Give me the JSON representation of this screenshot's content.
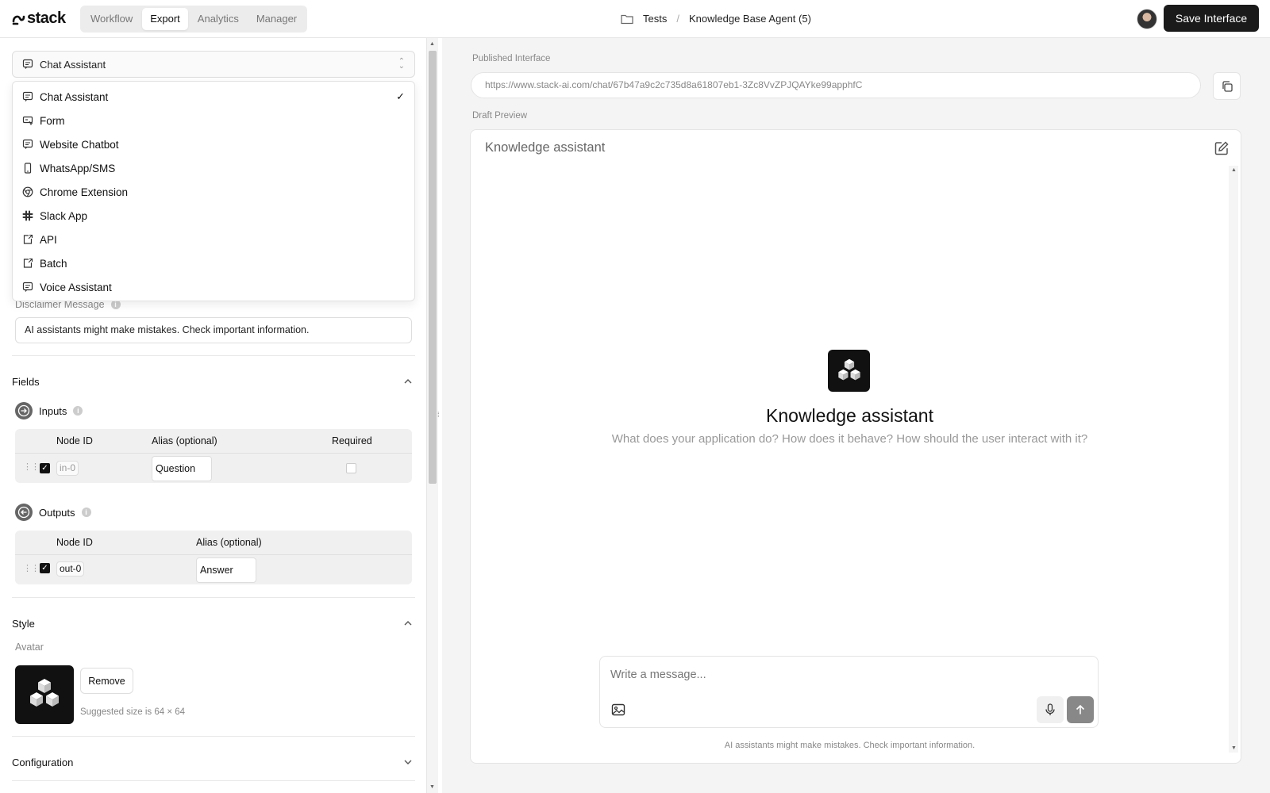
{
  "app": {
    "logo_text": "stack"
  },
  "nav": {
    "tabs": [
      "Workflow",
      "Export",
      "Analytics",
      "Manager"
    ],
    "active": "Export"
  },
  "breadcrumb": {
    "folder": "Tests",
    "project": "Knowledge Base Agent (5)"
  },
  "header": {
    "save_label": "Save Interface"
  },
  "export_type": {
    "selected": "Chat Assistant",
    "options": [
      "Chat Assistant",
      "Form",
      "Website Chatbot",
      "WhatsApp/SMS",
      "Chrome Extension",
      "Slack App",
      "API",
      "Batch",
      "Voice Assistant"
    ]
  },
  "disclaimer": {
    "label": "Disclaimer Message",
    "value": "AI assistants might make mistakes. Check important information."
  },
  "fields": {
    "title": "Fields",
    "inputs": {
      "title": "Inputs",
      "headers": [
        "Node ID",
        "Alias (optional)",
        "Required"
      ],
      "rows": [
        {
          "node_id": "in-0",
          "alias": "Question",
          "checked": true,
          "required": false
        }
      ]
    },
    "outputs": {
      "title": "Outputs",
      "headers": [
        "Node ID",
        "Alias (optional)"
      ],
      "rows": [
        {
          "node_id": "out-0",
          "alias": "Answer",
          "checked": true
        }
      ]
    }
  },
  "style": {
    "title": "Style",
    "avatar_label": "Avatar",
    "remove_label": "Remove",
    "suggested_size": "Suggested size is 64 × 64"
  },
  "configuration": {
    "title": "Configuration"
  },
  "published": {
    "label": "Published Interface",
    "url": "https://www.stack-ai.com/chat/67b47a9c2c735d8a61807eb1-3Zc8VvZPJQAYke99apphfC"
  },
  "draft": {
    "label": "Draft Preview",
    "title": "Knowledge assistant",
    "assistant_name": "Knowledge assistant",
    "description": "What does your application do? How does it behave? How should the user interact with it?",
    "placeholder": "Write a message...",
    "footer": "AI assistants might make mistakes. Check important information."
  },
  "colors": {
    "primary": "#1a1a1a",
    "panel_bg": "#f4f4f5",
    "muted": "#888888"
  }
}
